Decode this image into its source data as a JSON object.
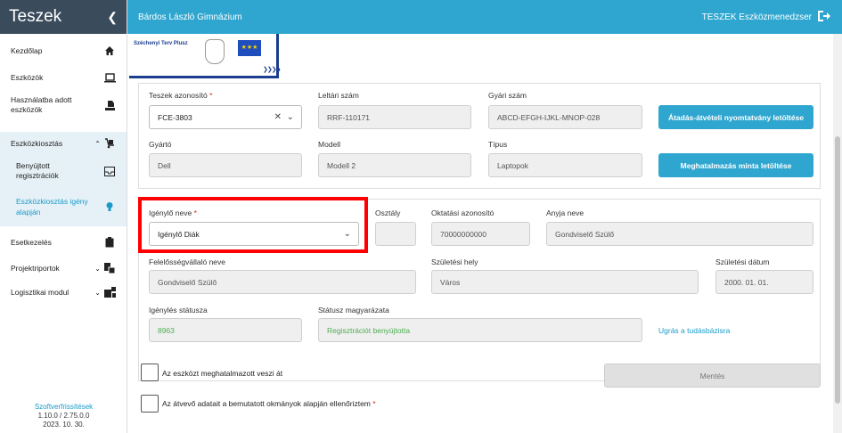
{
  "sidebar": {
    "title": "Teszek",
    "collapse_icon": "chevron-left-icon",
    "items": [
      {
        "label": "Kezdőlap",
        "icon": "home-icon"
      },
      {
        "label": "Eszközök",
        "icon": "laptop-icon"
      },
      {
        "label": "Használatba adott eszközök",
        "icon": "hand-box-icon"
      },
      {
        "label": "Eszközkiosztás",
        "icon": "hand-truck-icon"
      },
      {
        "label": "Benyújtott regisztrációk",
        "icon": "inbox-icon"
      },
      {
        "label": "Eszközkiosztás igény alapján",
        "icon": "lightbulb-icon"
      },
      {
        "label": "Esetkezelés",
        "icon": "clipboard-icon"
      },
      {
        "label": "Projektriportok",
        "icon": "report-icon"
      },
      {
        "label": "Logisztikai modul",
        "icon": "logistics-icon"
      }
    ],
    "footer": {
      "update_link": "Szoftverfrissítések",
      "version": "1.10.0 / 2.75.0.0",
      "date": "2023. 10. 30."
    }
  },
  "topbar": {
    "school": "Bárdos László Gimnázium",
    "app_name": "TESZEK Eszközmenedzser",
    "logout_icon": "logout-icon"
  },
  "logos": {
    "szechenyi": "Széchenyi Terv Plusz",
    "eu_flag": "★★★"
  },
  "device": {
    "id_label": "Teszek azonosító",
    "id_value": "FCE-3803",
    "loan_label": "Leltári szám",
    "loan_value": "RRF-110171",
    "serial_label": "Gyári szám",
    "serial_value": "ABCD-EFGH-IJKL-MNOP-028",
    "handover_btn": "Átadás-átvételi nyomtatvány letöltése",
    "maker_label": "Gyártó",
    "maker_value": "Dell",
    "model_label": "Modell",
    "model_value": "Modell 2",
    "type_label": "Típus",
    "type_value": "Laptopok",
    "proxy_btn": "Meghatalmazás minta letöltése"
  },
  "requester": {
    "name_label": "Igénylő neve",
    "name_value": "Igénylő Diák",
    "class_label": "Osztály",
    "class_value": "",
    "edu_id_label": "Oktatási azonosító",
    "edu_id_value": "70000000000",
    "mother_label": "Anyja neve",
    "mother_value": "Gondviselő Szülő",
    "guardian_label": "Felelősségvállaló neve",
    "guardian_value": "Gondviselő Szülő",
    "birthplace_label": "Születési hely",
    "birthplace_value": "Város",
    "birthdate_label": "Születési dátum",
    "birthdate_value": "2000. 01. 01.",
    "status_label": "Igénylés státusza",
    "status_value": "8963",
    "status_desc_label": "Státusz magyarázata",
    "status_desc_value": "Regisztrációt benyújtotta",
    "kb_link": "Ugrás a tudásbázisra"
  },
  "footer_form": {
    "proxy_checkbox": "Az eszközt meghatalmazott veszi át",
    "verify_checkbox": "Az átvevő adatait a bemutatott okmányok alapján ellenőriztem",
    "save_btn": "Mentés"
  }
}
